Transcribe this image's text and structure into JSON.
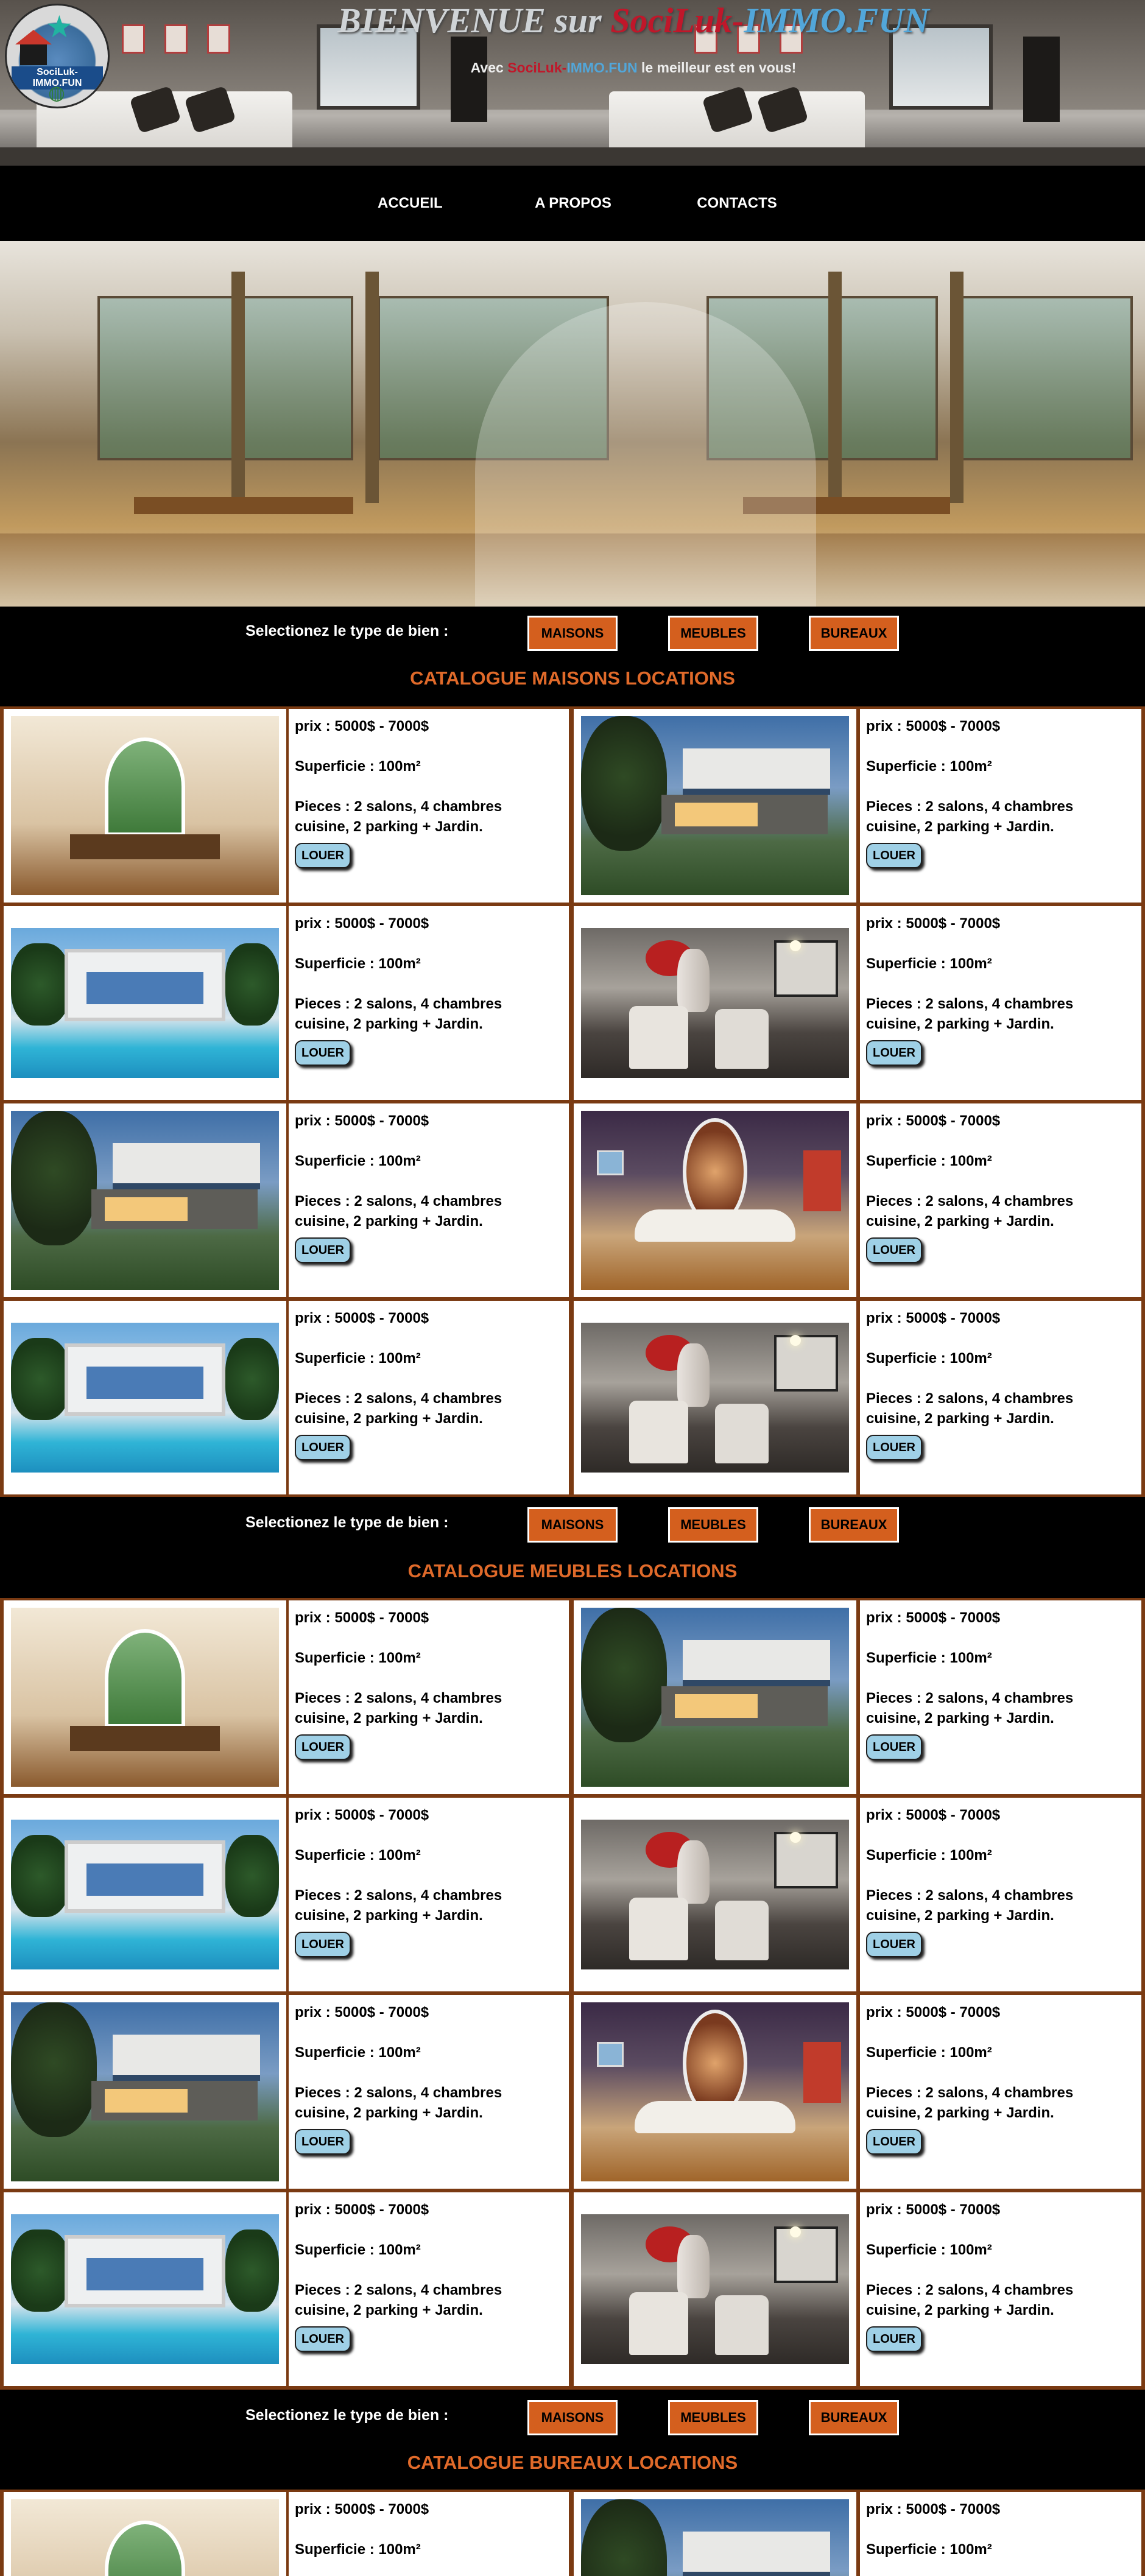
{
  "header": {
    "title_part1": "BIENVENUE sur ",
    "title_brand_red": "SociLuk-",
    "title_brand_blue": "IMMO.FUN",
    "subtitle_part1": "Avec ",
    "subtitle_brand_red": "SociLuk-",
    "subtitle_brand_blue": "IMMO.FUN",
    "subtitle_part2": " le meilleur est en vous!",
    "logo_text": "SociLuk-IMMO.FUN",
    "colors": {
      "brand_red": "#c0172a",
      "brand_blue": "#52a6d9",
      "accent_orange": "#d45f1e"
    }
  },
  "nav": {
    "items": [
      {
        "label": "ACCUEIL"
      },
      {
        "label": "A PROPOS"
      },
      {
        "label": "CONTACTS"
      }
    ]
  },
  "selector": {
    "label": "Selectionez le type de bien :",
    "buttons": [
      "MAISONS",
      "MEUBLES",
      "BUREAUX"
    ]
  },
  "sections": [
    {
      "title": "CATALOGUE MAISONS LOCATIONS"
    },
    {
      "title": "CATALOGUE MEUBLES LOCATIONS"
    },
    {
      "title": "CATALOGUE BUREAUX LOCATIONS"
    }
  ],
  "listing": {
    "price": "prix : 5000$ - 7000$",
    "area": "Superficie : 100m²",
    "rooms_line1": "Pieces : 2 salons, 4 chambres",
    "rooms_line2": "cuisine, 2 parking + Jardin.",
    "button": "LOUER"
  }
}
